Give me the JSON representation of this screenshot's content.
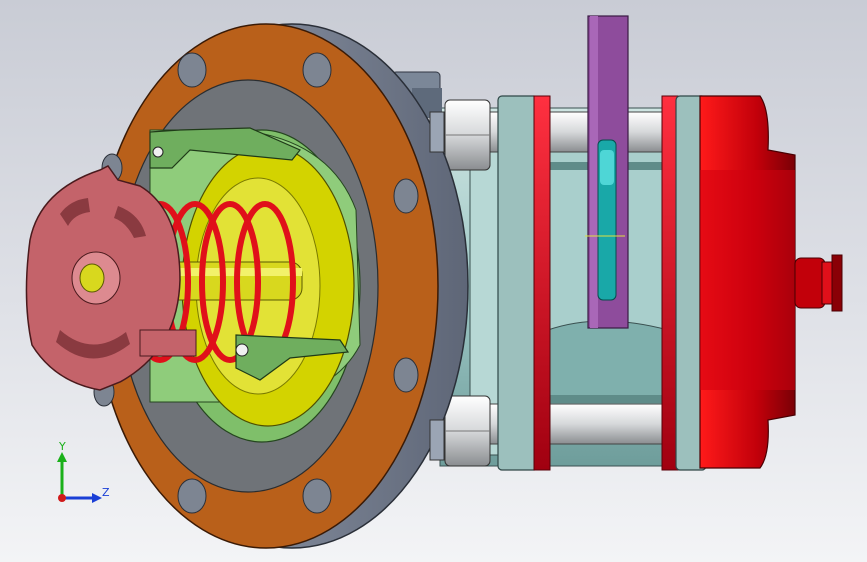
{
  "triad": {
    "y_label": "Y",
    "z_label": "Z",
    "colors": {
      "y": "#1ab01a",
      "z": "#1a3fd6",
      "x": "#d01a1a"
    }
  },
  "colors": {
    "flange": "#b9601a",
    "housing_grey": "#6f7378",
    "diaphragm_green": "#7fbf6a",
    "disc_yellow": "#d3d300",
    "spring_red": "#e0101a",
    "handwheel_pink": "#c4636a",
    "body_cyan": "#9fc8c6",
    "lever_purple": "#8e4c9c",
    "actuator_red": "#c2000a",
    "gasket_red": "#d8001a",
    "bolt_grey": "#d6d8da"
  }
}
